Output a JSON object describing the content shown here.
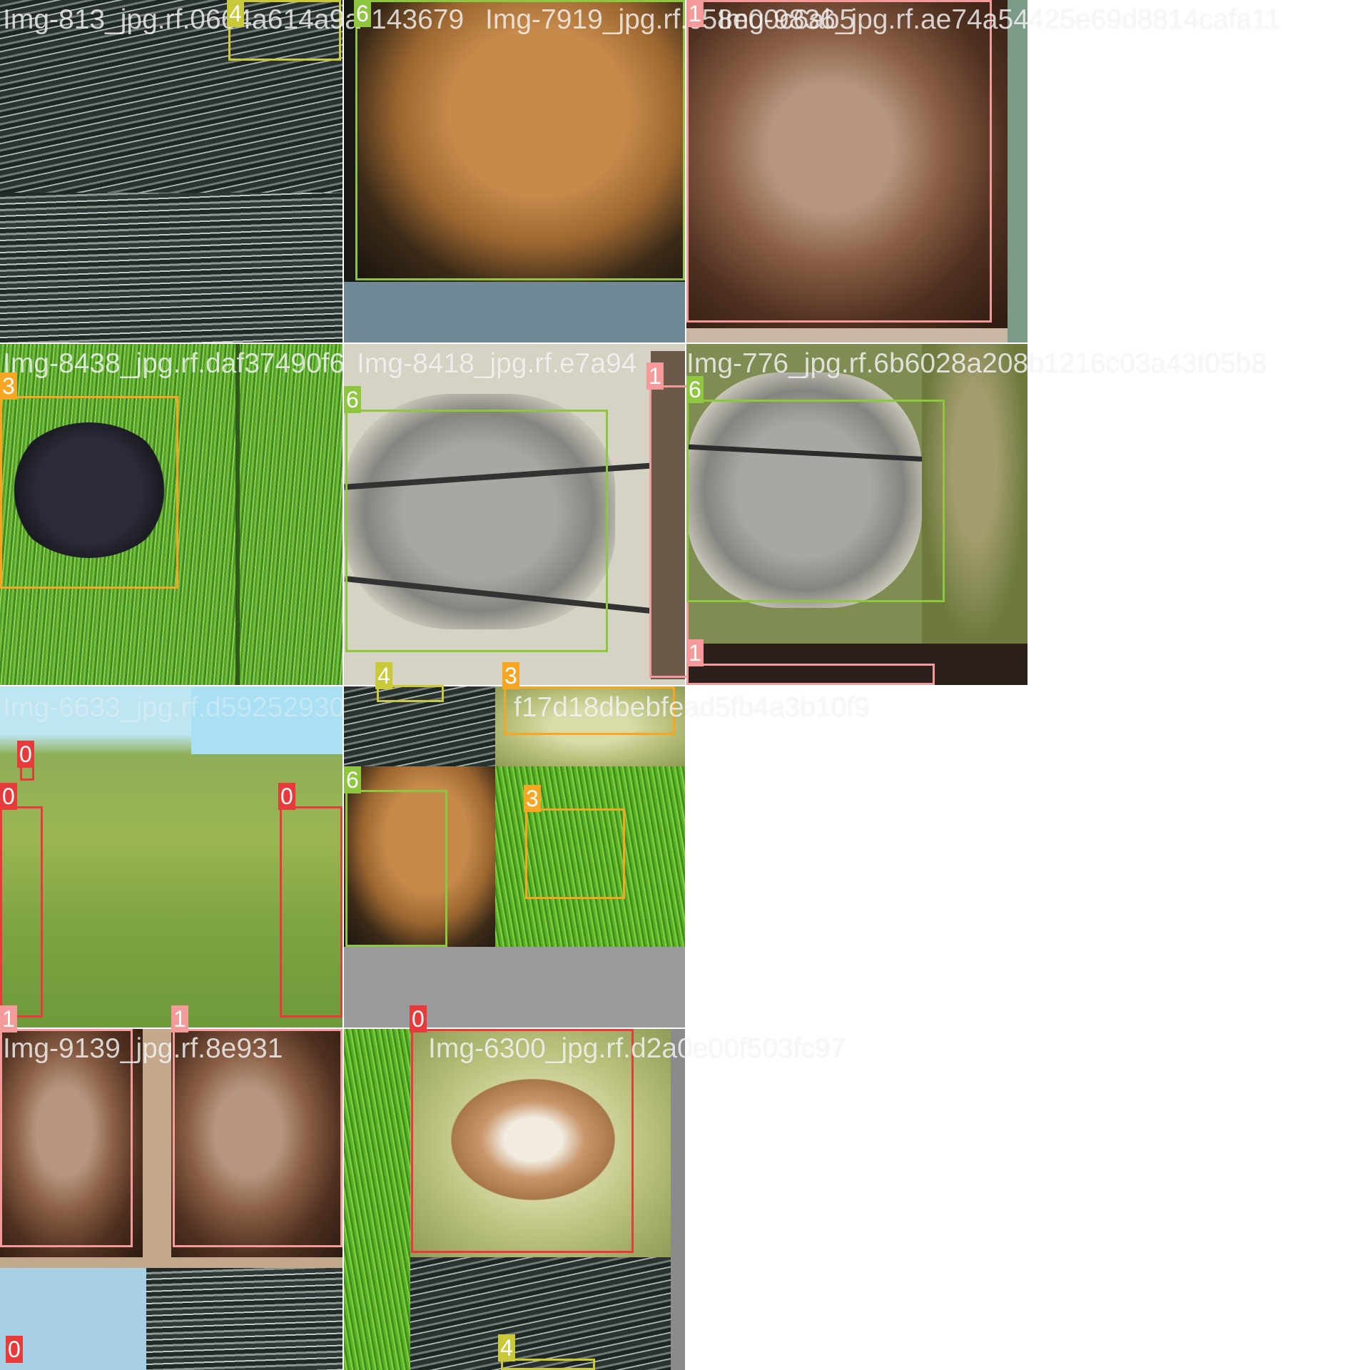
{
  "filenames": {
    "tile_0_0": "Img-813_jpg.rf.0664a614a9a",
    "tile_0_1": "Img-7919_jpg.rf.c58e00c6ab5",
    "tile_0_2": "Img-9836_jpg.rf.ae74a54425e69d8814cafa11",
    "tile_0_x": "143679",
    "tile_1_0": "Img-8438_jpg.rf.daf37490f6",
    "tile_1_1": "Img-8418_jpg.rf.e7a94",
    "tile_1_2": "Img-776_jpg.rf.6b6028a208b1216c03a43f05b8",
    "tile_2_0": "Img-6633_jpg.rf.d59252930",
    "tile_2_1": "f17d18dbebfead5fb4a3b10f9",
    "tile_3_0": "Img-9139_jpg.rf.8e931",
    "tile_3_1": "Img-6300_jpg.rf.d2a0e00f503fc97"
  },
  "class_colors": {
    "0": "#e8393b",
    "1": "#f59a9a",
    "3": "#f5a623",
    "4": "#c9c93a",
    "6": "#8ec63f"
  },
  "labels": {
    "l1": "4",
    "l2": "6",
    "l3": "1",
    "l4": "3",
    "l5": "6",
    "l6": "1",
    "l7": "6",
    "l8": "1",
    "l9": "0",
    "l10": "0",
    "l11": "0",
    "l12": "4",
    "l13": "3",
    "l14": "6",
    "l15": "3",
    "l16": "1",
    "l17": "1",
    "l18": "0",
    "l19": "0",
    "l20": "4"
  }
}
